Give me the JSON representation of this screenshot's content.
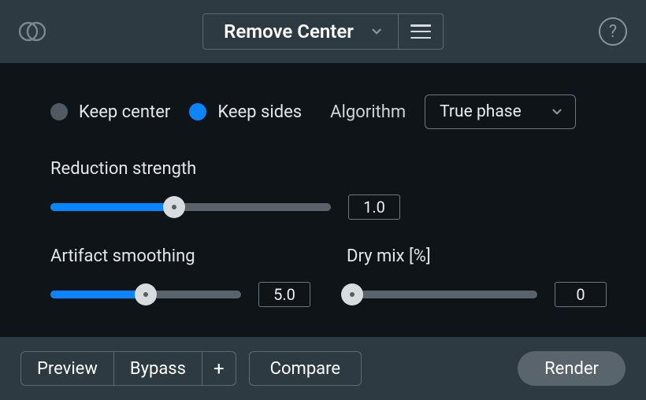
{
  "header": {
    "title": "Remove Center"
  },
  "modes": {
    "keep_center_label": "Keep center",
    "keep_sides_label": "Keep sides",
    "active": "keep_sides"
  },
  "algorithm": {
    "label": "Algorithm",
    "value": "True phase"
  },
  "reduction": {
    "label": "Reduction strength",
    "value": "1.0",
    "fill_pct": 44,
    "thumb_pct": 44
  },
  "artifact": {
    "label": "Artifact smoothing",
    "value": "5.0",
    "fill_pct": 50,
    "thumb_pct": 50
  },
  "drymix": {
    "label": "Dry mix [%]",
    "value": "0",
    "fill_pct": 0,
    "thumb_pct": 3
  },
  "footer": {
    "preview": "Preview",
    "bypass": "Bypass",
    "plus": "+",
    "compare": "Compare",
    "render": "Render"
  },
  "glyphs": {
    "help": "?"
  }
}
